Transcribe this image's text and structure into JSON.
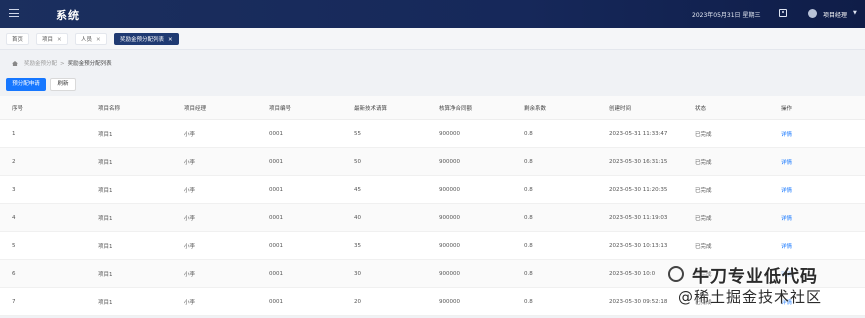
{
  "header": {
    "app_title": "系统",
    "datetime": "2023年05月31日 星期三",
    "username": "项目经理",
    "caret": "▼"
  },
  "tabs": [
    {
      "label": "首页",
      "closable": false
    },
    {
      "label": "项目",
      "closable": true
    },
    {
      "label": "人员",
      "closable": true
    },
    {
      "label": "奖励金预分配列表",
      "closable": true,
      "active": true
    }
  ],
  "tab_close": "✕",
  "breadcrumb": {
    "parent": "奖励金预分配",
    "separator": ">",
    "current": "奖励金预分配列表"
  },
  "toolbar": {
    "primary_label": "预分配申请",
    "refresh_label": "刷新"
  },
  "table": {
    "columns": [
      "序号",
      "项目名称",
      "项目经理",
      "项目编号",
      "最新技术请算",
      "核算净合同额",
      "剩余系数",
      "创建时间",
      "状态",
      "操作"
    ],
    "rows": [
      [
        "1",
        "项目1",
        "小李",
        "0001",
        "55",
        "900000",
        "0.8",
        "2023-05-31 11:33:47",
        "已完成",
        "详情"
      ],
      [
        "2",
        "项目1",
        "小李",
        "0001",
        "50",
        "900000",
        "0.8",
        "2023-05-30 16:31:15",
        "已完成",
        "详情"
      ],
      [
        "3",
        "项目1",
        "小李",
        "0001",
        "45",
        "900000",
        "0.8",
        "2023-05-30 11:20:35",
        "已完成",
        "详情"
      ],
      [
        "4",
        "项目1",
        "小李",
        "0001",
        "40",
        "900000",
        "0.8",
        "2023-05-30 11:19:03",
        "已完成",
        "详情"
      ],
      [
        "5",
        "项目1",
        "小李",
        "0001",
        "35",
        "900000",
        "0.8",
        "2023-05-30 10:13:13",
        "已完成",
        "详情"
      ],
      [
        "6",
        "项目1",
        "小李",
        "0001",
        "30",
        "900000",
        "0.8",
        "2023-05-30 10:0",
        "已完成",
        "详情"
      ],
      [
        "7",
        "项目1",
        "小李",
        "0001",
        "20",
        "900000",
        "0.8",
        "2023-05-30 09:52:18",
        "已完成",
        "详情"
      ]
    ]
  },
  "watermark": {
    "line1": "牛刀专业低代码",
    "line2": "@稀土掘金技术社区"
  }
}
